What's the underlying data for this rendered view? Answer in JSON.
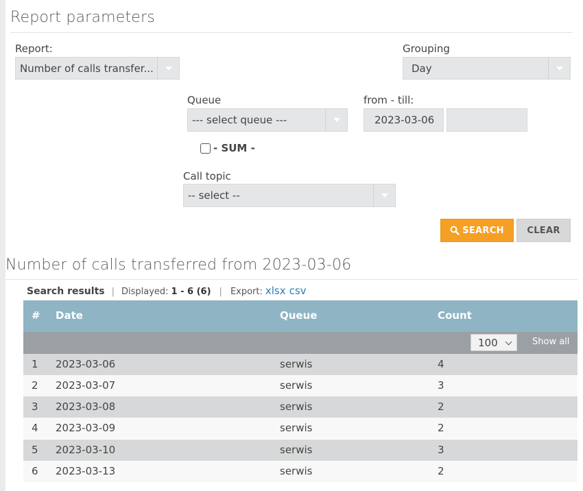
{
  "params": {
    "title": "Report parameters",
    "report_label": "Report:",
    "report_value": "Number of calls transfer...",
    "grouping_label": "Grouping",
    "grouping_value": "Day",
    "queue_label": "Queue",
    "queue_value": "--- select queue ---",
    "date_label": "from - till:",
    "date_from": "2023-03-06",
    "date_till": "",
    "sum_label": "- SUM -",
    "topic_label": "Call topic",
    "topic_value": "-- select --",
    "search_label": "SEARCH",
    "clear_label": "CLEAR"
  },
  "results": {
    "title": "Number of calls transferred from 2023-03-06",
    "summary_label": "Search results",
    "displayed_label": "Displayed:",
    "displayed_value": "1 - 6 (6)",
    "export_label": "Export:",
    "export_xlsx": "xlsx",
    "export_csv": "csv",
    "columns": [
      "#",
      "Date",
      "Queue",
      "Count"
    ],
    "page_size": "100",
    "show_all": "Show all",
    "rows": [
      {
        "num": "1",
        "date": "2023-03-06",
        "queue": "serwis",
        "count": "4"
      },
      {
        "num": "2",
        "date": "2023-03-07",
        "queue": "serwis",
        "count": "3"
      },
      {
        "num": "3",
        "date": "2023-03-08",
        "queue": "serwis",
        "count": "2"
      },
      {
        "num": "4",
        "date": "2023-03-09",
        "queue": "serwis",
        "count": "2"
      },
      {
        "num": "5",
        "date": "2023-03-10",
        "queue": "serwis",
        "count": "3"
      },
      {
        "num": "6",
        "date": "2023-03-13",
        "queue": "serwis",
        "count": "2"
      }
    ]
  },
  "colors": {
    "accent": "#f5a025",
    "table_header": "#8fb4c3",
    "toolbar": "#9aa0a3",
    "link": "#2c7fb0"
  }
}
